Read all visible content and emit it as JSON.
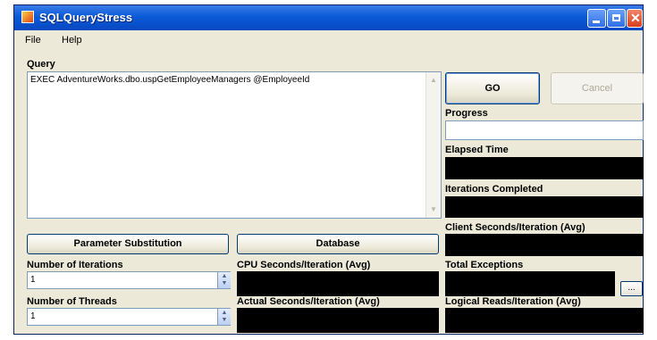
{
  "window": {
    "title": "SQLQueryStress"
  },
  "menu": {
    "file": "File",
    "help": "Help"
  },
  "query": {
    "label": "Query",
    "text": "EXEC AdventureWorks.dbo.uspGetEmployeeManagers @EmployeeId"
  },
  "buttons": {
    "go": "GO",
    "cancel": "Cancel",
    "param_sub": "Parameter Substitution",
    "database": "Database",
    "ellipsis": "..."
  },
  "labels": {
    "progress": "Progress",
    "elapsed": "Elapsed Time",
    "iterations_completed": "Iterations Completed",
    "client_seconds": "Client Seconds/Iteration (Avg)",
    "num_iterations": "Number of Iterations",
    "cpu_seconds": "CPU Seconds/Iteration (Avg)",
    "total_exceptions": "Total Exceptions",
    "num_threads": "Number of Threads",
    "actual_seconds": "Actual Seconds/Iteration (Avg)",
    "logical_reads": "Logical Reads/Iteration (Avg)"
  },
  "inputs": {
    "iterations_value": "1",
    "threads_value": "1"
  }
}
